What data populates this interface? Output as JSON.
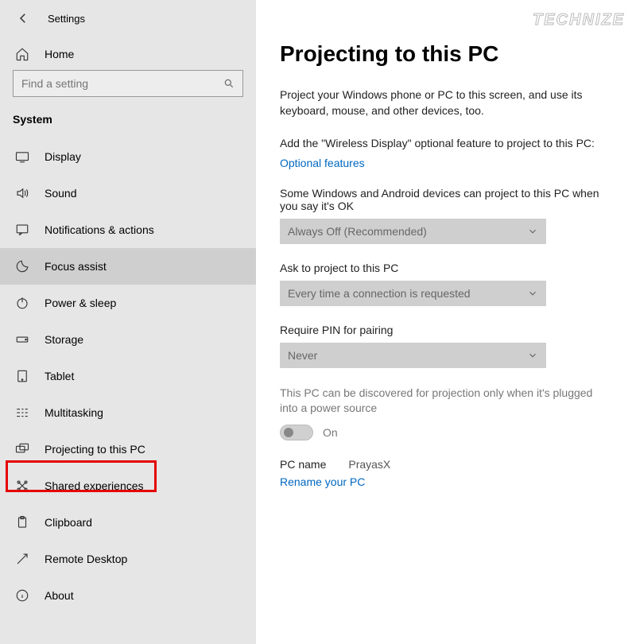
{
  "header": {
    "settings_label": "Settings"
  },
  "sidebar": {
    "home_label": "Home",
    "search_placeholder": "Find a setting",
    "category_label": "System",
    "items": [
      {
        "label": "Display"
      },
      {
        "label": "Sound"
      },
      {
        "label": "Notifications & actions"
      },
      {
        "label": "Focus assist"
      },
      {
        "label": "Power & sleep"
      },
      {
        "label": "Storage"
      },
      {
        "label": "Tablet"
      },
      {
        "label": "Multitasking"
      },
      {
        "label": "Projecting to this PC"
      },
      {
        "label": "Shared experiences"
      },
      {
        "label": "Clipboard"
      },
      {
        "label": "Remote Desktop"
      },
      {
        "label": "About"
      }
    ]
  },
  "main": {
    "title": "Projecting to this PC",
    "description": "Project your Windows phone or PC to this screen, and use its keyboard, mouse, and other devices, too.",
    "feature_hint": "Add the \"Wireless Display\" optional feature to project to this PC:",
    "optional_features_link": "Optional features",
    "project_label": "Some Windows and Android devices can project to this PC when you say it's OK",
    "project_value": "Always Off (Recommended)",
    "ask_label": "Ask to project to this PC",
    "ask_value": "Every time a connection is requested",
    "pin_label": "Require PIN for pairing",
    "pin_value": "Never",
    "discover_note": "This PC can be discovered for projection only when it's plugged into a power source",
    "toggle_label": "On",
    "pc_name_label": "PC name",
    "pc_name_value": "PrayasX",
    "rename_link": "Rename your PC"
  },
  "watermark": "TECHNIZE"
}
